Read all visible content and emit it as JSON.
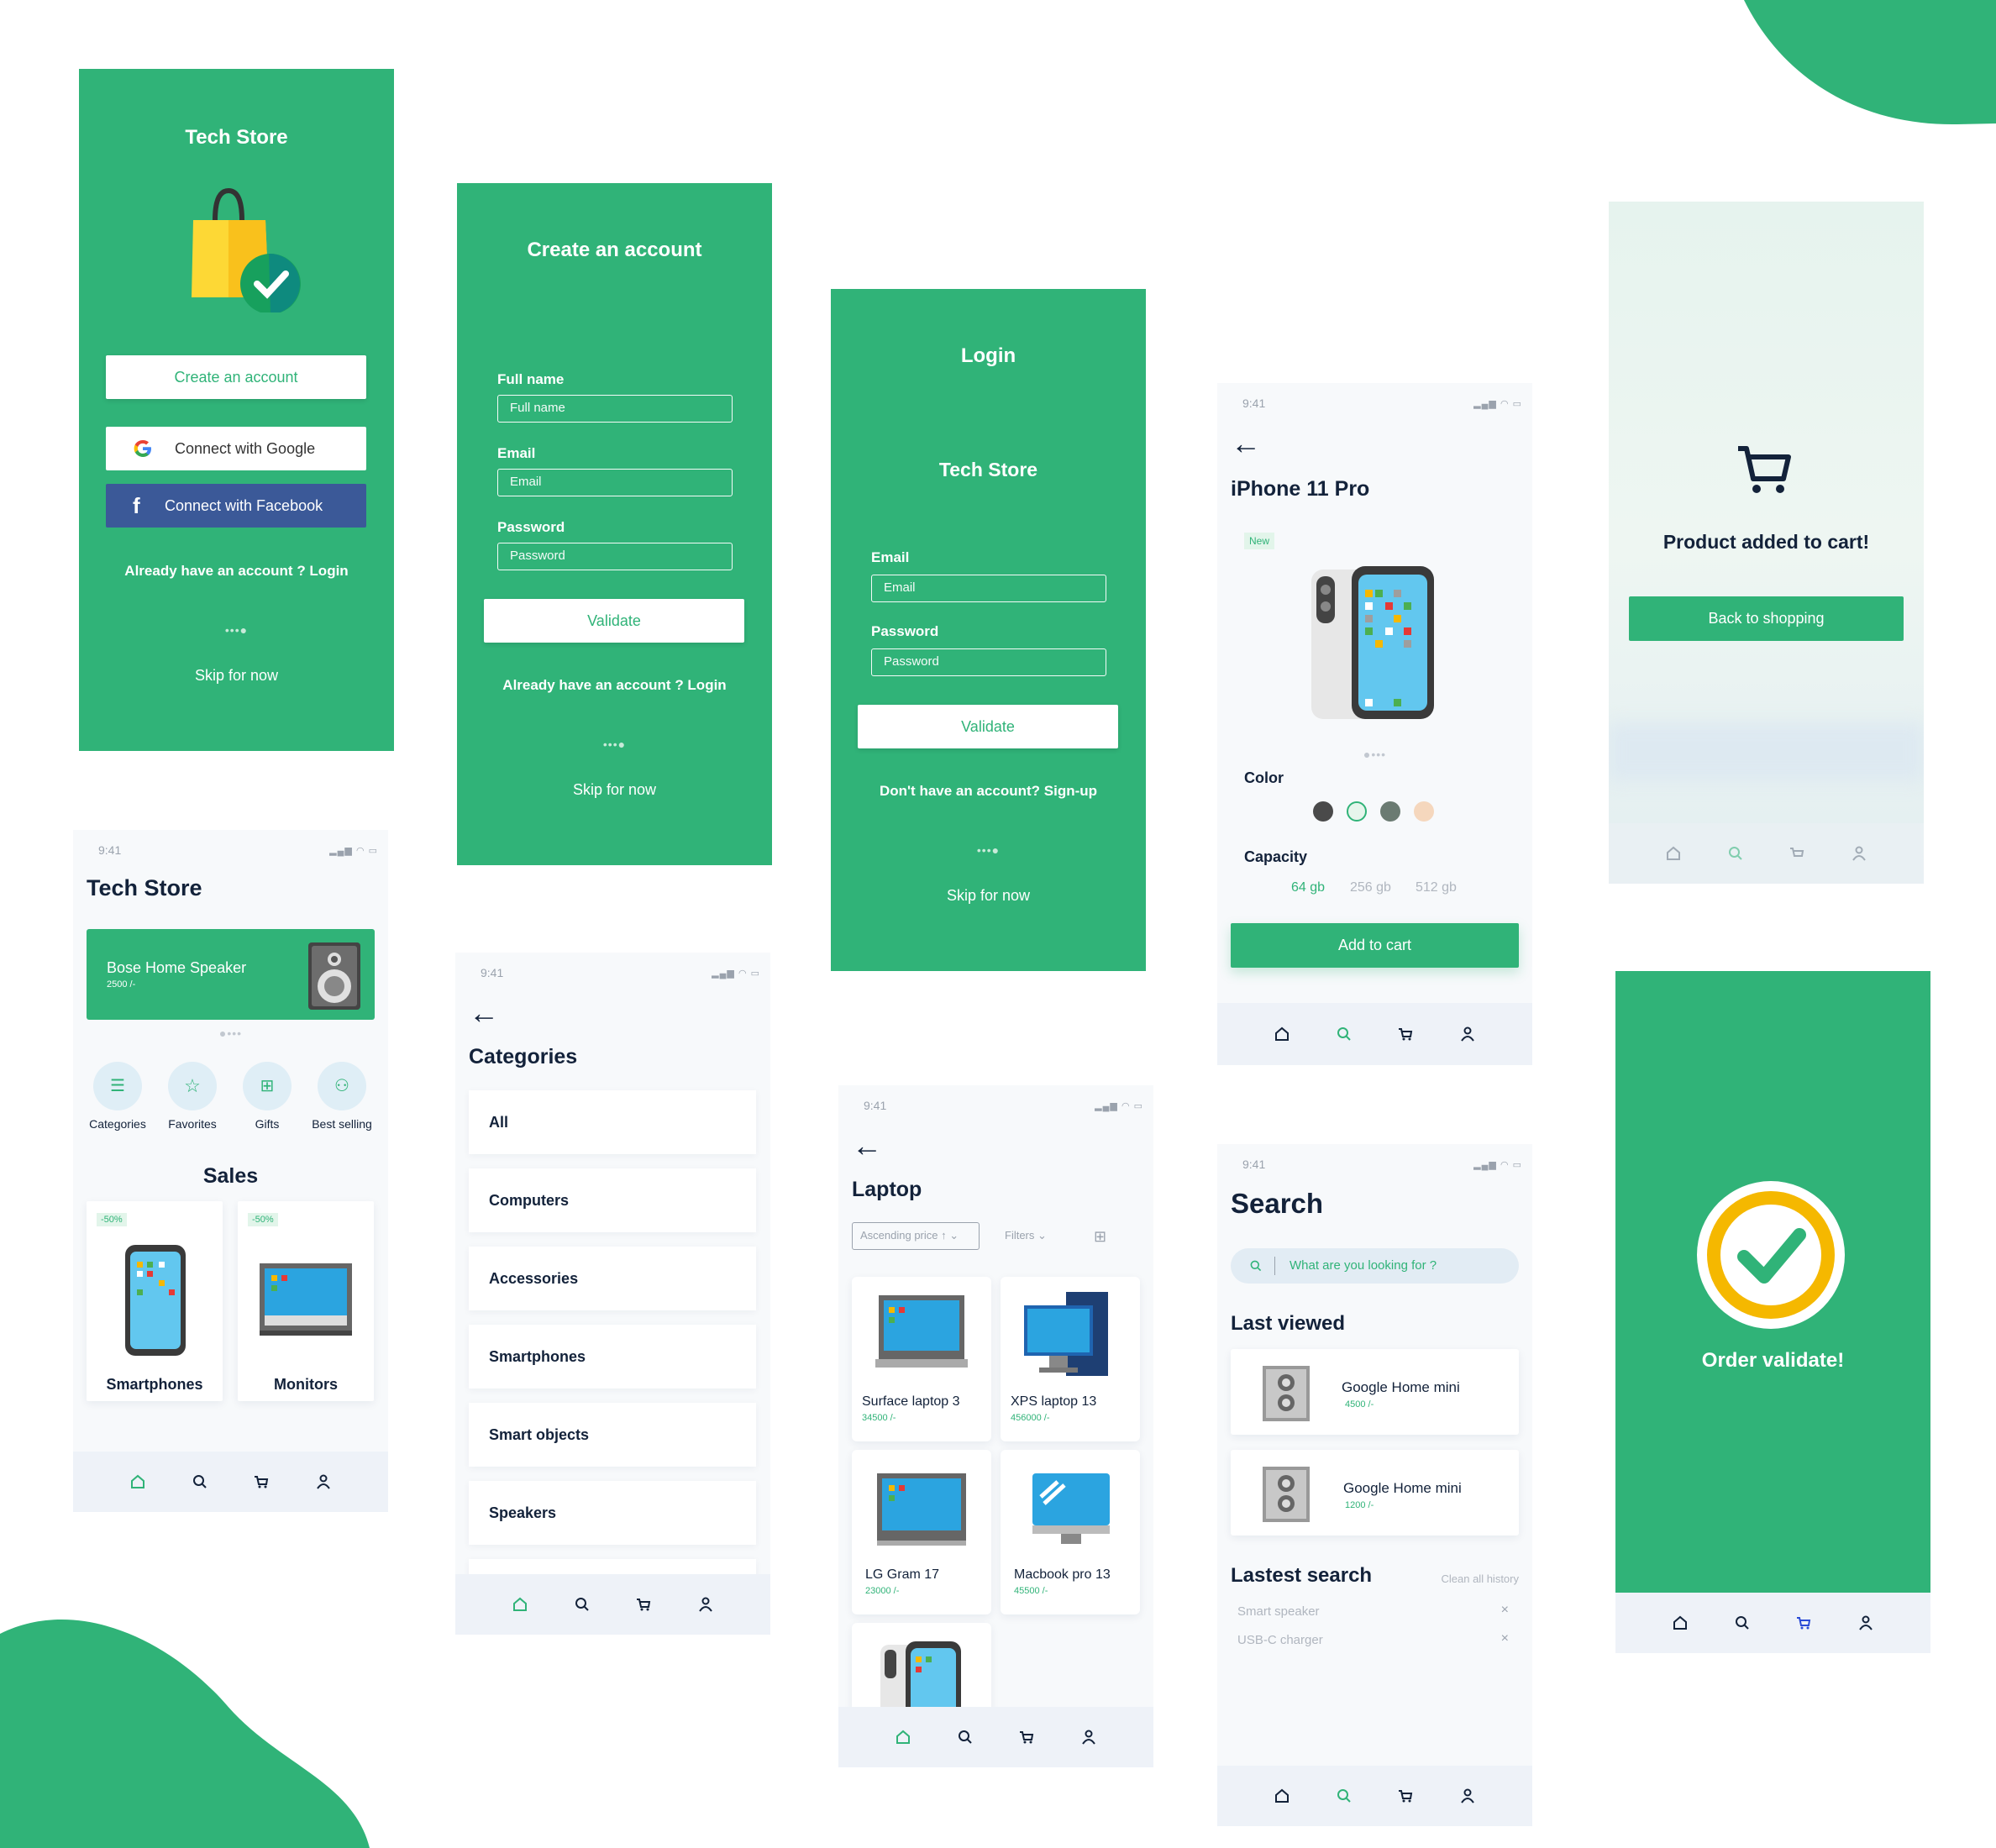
{
  "onboarding": {
    "title": "Tech Store",
    "create_btn": "Create an account",
    "google_btn": "Connect with Google",
    "facebook_btn": "Connect with Facebook",
    "login_link": "Already have an account ? Login",
    "dots": "•••●",
    "skip": "Skip for now"
  },
  "signup": {
    "title": "Create an account",
    "fullname_label": "Full name",
    "fullname_placeholder": "Full name",
    "email_label": "Email",
    "email_placeholder": "Email",
    "password_label": "Password",
    "password_placeholder": "Password",
    "validate_btn": "Validate",
    "login_link": "Already have an account ? Login",
    "dots": "•••●",
    "skip": "Skip for now"
  },
  "login": {
    "title": "Login",
    "brand": "Tech Store",
    "email_label": "Email",
    "email_placeholder": "Email",
    "password_label": "Password",
    "password_placeholder": "Password",
    "validate_btn": "Validate",
    "signup_link": "Don't have an account? Sign-up",
    "dots": "•••●",
    "skip": "Skip for now"
  },
  "product": {
    "time": "9:41",
    "title": "iPhone 11 Pro",
    "badge": "New",
    "dots": "●•••",
    "color_label": "Color",
    "colors": [
      "#4a4a4a",
      "#e6f5ec",
      "#6b7b72",
      "#f5d7bd"
    ],
    "capacity_label": "Capacity",
    "capacities": [
      "64 gb",
      "256 gb",
      "512 gb"
    ],
    "add_btn": "Add to cart"
  },
  "added": {
    "message": "Product added to cart!",
    "back_btn": "Back to shopping"
  },
  "home": {
    "time": "9:41",
    "title": "Tech Store",
    "banner_title": "Bose Home Speaker",
    "banner_price": "2500 /-",
    "dots": "●•••",
    "quick": [
      "Categories",
      "Favorites",
      "Gifts",
      "Best selling"
    ],
    "sales_title": "Sales",
    "sales": [
      {
        "badge": "-50%",
        "name": "Smartphones"
      },
      {
        "badge": "-50%",
        "name": "Monitors"
      }
    ]
  },
  "categories": {
    "time": "9:41",
    "title": "Categories",
    "items": [
      "All",
      "Computers",
      "Accessories",
      "Smartphones",
      "Smart objects",
      "Speakers"
    ]
  },
  "laptop": {
    "time": "9:41",
    "title": "Laptop",
    "sort": "Ascending price ↑ ⌄",
    "filters": "Filters ⌄",
    "products": [
      {
        "name": "Surface laptop 3",
        "price": "34500 /-"
      },
      {
        "name": "XPS laptop 13",
        "price": "456000 /-"
      },
      {
        "name": "LG Gram 17",
        "price": "23000 /-"
      },
      {
        "name": "Macbook pro 13",
        "price": "45500 /-"
      }
    ]
  },
  "search": {
    "time": "9:41",
    "title": "Search",
    "placeholder": "What are you looking for ?",
    "last_viewed": "Last viewed",
    "viewed": [
      {
        "name": "Google Home mini",
        "price": "4500 /-"
      },
      {
        "name": "Google Home mini",
        "price": "1200 /-"
      }
    ],
    "latest": "Lastest search",
    "clear": "Clean all history",
    "history": [
      "Smart speaker",
      "USB-C charger"
    ],
    "remove": "×"
  },
  "order": {
    "message": "Order validate!"
  },
  "colors": {
    "brand": "#30b378",
    "facebook": "#3b5998",
    "nav_bg": "#eef2f8",
    "dark": "#13223a",
    "yellow": "#f5b800"
  }
}
